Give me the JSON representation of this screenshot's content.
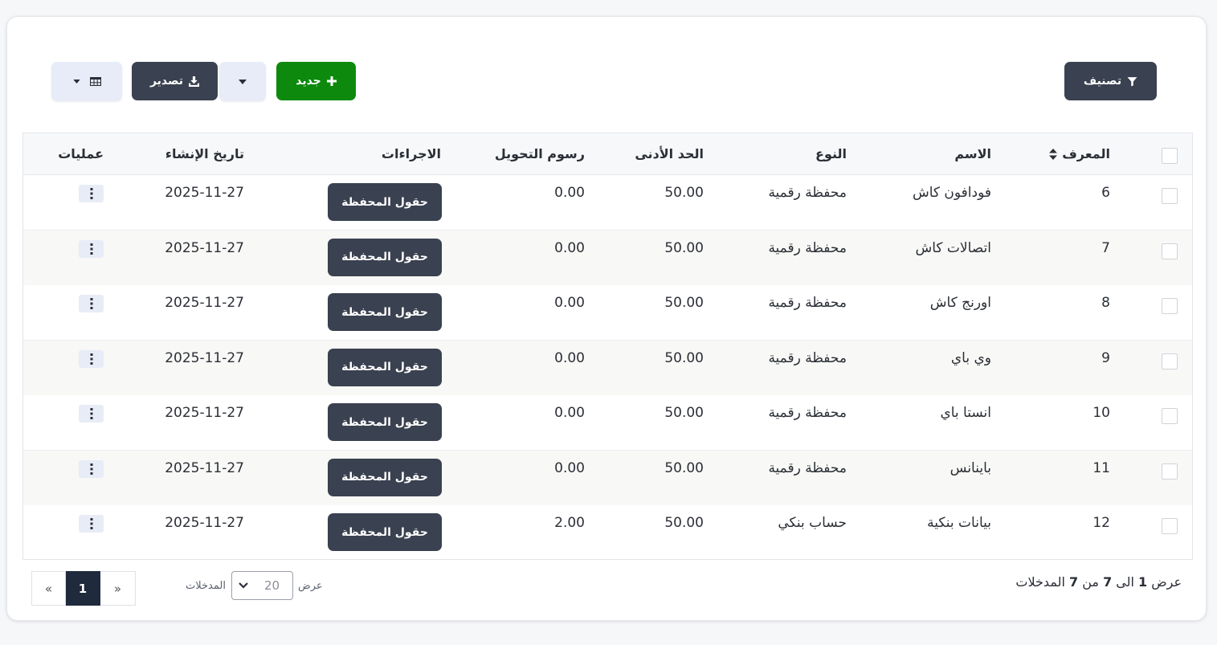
{
  "toolbar": {
    "filter_label": "تصنيف",
    "new_label": "جديد",
    "export_label": "تصدير"
  },
  "table": {
    "columns": {
      "id": "المعرف",
      "name": "الاسم",
      "type": "النوع",
      "min": "الحد الأدنى",
      "fee": "رسوم التحويل",
      "actions": "الاجراءات",
      "created": "تاريخ الإنشاء",
      "ops": "عمليات"
    },
    "action_button_label": "حقول المحفظة",
    "rows": [
      {
        "id": "6",
        "name": "فودافون كاش",
        "type": "محفظة رقمية",
        "min": "50.00",
        "fee": "0.00",
        "created": "2025-11-27"
      },
      {
        "id": "7",
        "name": "اتصالات كاش",
        "type": "محفظة رقمية",
        "min": "50.00",
        "fee": "0.00",
        "created": "2025-11-27"
      },
      {
        "id": "8",
        "name": "اورنج كاش",
        "type": "محفظة رقمية",
        "min": "50.00",
        "fee": "0.00",
        "created": "2025-11-27"
      },
      {
        "id": "9",
        "name": "وي باي",
        "type": "محفظة رقمية",
        "min": "50.00",
        "fee": "0.00",
        "created": "2025-11-27"
      },
      {
        "id": "10",
        "name": "انستا باي",
        "type": "محفظة رقمية",
        "min": "50.00",
        "fee": "0.00",
        "created": "2025-11-27"
      },
      {
        "id": "11",
        "name": "باينانس",
        "type": "محفظة رقمية",
        "min": "50.00",
        "fee": "0.00",
        "created": "2025-11-27"
      },
      {
        "id": "12",
        "name": "بيانات بنكية",
        "type": "حساب بنكي",
        "min": "50.00",
        "fee": "2.00",
        "created": "2025-11-27"
      }
    ]
  },
  "footer": {
    "info_prefix": "عرض",
    "info_from": "1",
    "info_to_word": "الى",
    "info_to": "7",
    "info_of_word": "من",
    "info_total": "7",
    "info_suffix": "المدخلات",
    "show_label": "عرض",
    "page_size": "20",
    "entries_label": "المدخلات"
  },
  "pagination": {
    "prev": "«",
    "current": "1",
    "next": "»"
  },
  "colors": {
    "dark_button": "#3a4150",
    "green_button": "#0d8a0d",
    "light_button": "#e7ecf8",
    "active_page": "#1f2a3c"
  },
  "icons": {
    "filter": "filter-icon",
    "plus": "plus-icon",
    "caret": "caret-down-icon",
    "download": "download-icon",
    "grid": "table-grid-icon",
    "sort": "sort-icon",
    "kebab": "kebab-menu-icon"
  }
}
